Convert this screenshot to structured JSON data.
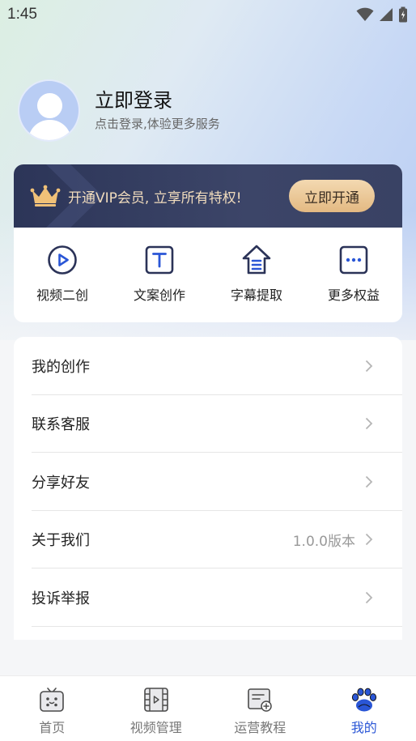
{
  "status_bar": {
    "time": "1:45"
  },
  "profile": {
    "login_title": "立即登录",
    "login_subtitle": "点击登录,体验更多服务"
  },
  "vip": {
    "promo_text": "开通VIP会员, 立享所有特权!",
    "button_label": "立即开通"
  },
  "features": [
    {
      "label": "视频二创",
      "icon": "play-circle-icon"
    },
    {
      "label": "文案创作",
      "icon": "text-icon"
    },
    {
      "label": "字幕提取",
      "icon": "subtitle-extract-icon"
    },
    {
      "label": "更多权益",
      "icon": "more-dots-icon"
    }
  ],
  "menu": [
    {
      "label": "我的创作",
      "extra": ""
    },
    {
      "label": "联系客服",
      "extra": ""
    },
    {
      "label": "分享好友",
      "extra": ""
    },
    {
      "label": "关于我们",
      "extra": "1.0.0版本"
    },
    {
      "label": "投诉举报",
      "extra": ""
    }
  ],
  "tabs": [
    {
      "label": "首页",
      "icon": "home-tv-icon",
      "active": false
    },
    {
      "label": "视频管理",
      "icon": "film-icon",
      "active": false
    },
    {
      "label": "运营教程",
      "icon": "tutorial-icon",
      "active": false
    },
    {
      "label": "我的",
      "icon": "paw-icon",
      "active": true
    }
  ],
  "colors": {
    "accent": "#2a56d6",
    "vip_banner": "#2c3558",
    "vip_gold": "#e3b982"
  }
}
